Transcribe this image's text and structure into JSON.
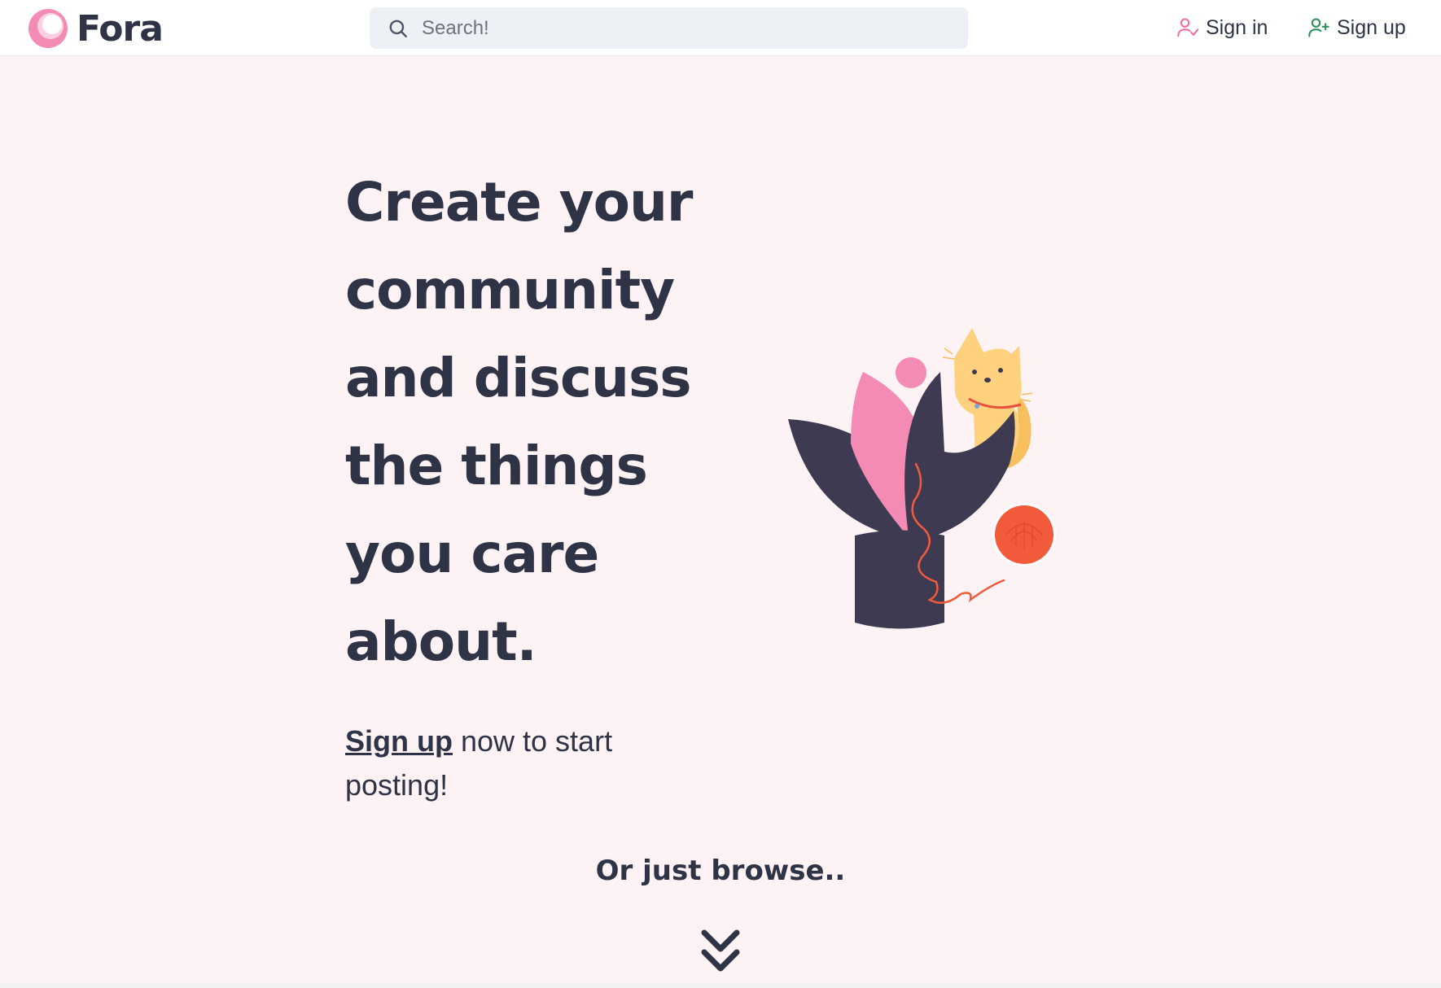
{
  "header": {
    "brand": "Fora",
    "search_placeholder": "Search!",
    "sign_in_label": "Sign in",
    "sign_up_label": "Sign up"
  },
  "hero": {
    "title": "Create your community and discuss the things you care about.",
    "cta_link": "Sign up",
    "cta_rest": " now to start posting!"
  },
  "browse": {
    "label": "Or just browse.."
  },
  "colors": {
    "background": "#fdf2f4",
    "text": "#2e3346",
    "brand_pink": "#f48bb5",
    "leaf_dark": "#3d3a52",
    "yarn": "#f25a3c",
    "cat": "#fdd17d",
    "sign_in_icon": "#ec6fa0",
    "sign_up_icon": "#2f8f5b"
  },
  "icons": [
    "fora-logo-icon",
    "search-icon",
    "user-check-icon",
    "user-plus-icon",
    "double-chevron-down-icon"
  ]
}
